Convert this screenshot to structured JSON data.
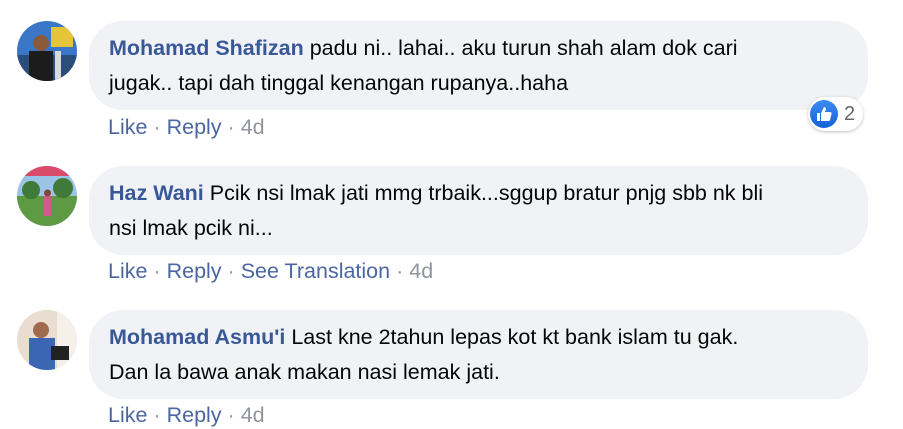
{
  "comments": [
    {
      "author": "Mohamad Shafizan",
      "text": "padu ni.. lahai.. aku turun shah alam dok cari\njugak.. tapi dah tinggal kenangan rupanya..haha",
      "actions": {
        "like": "Like",
        "reply": "Reply"
      },
      "time": "4d",
      "reaction": {
        "icon": "thumbs-up-icon",
        "count": "2"
      }
    },
    {
      "author": "Haz Wani",
      "text": "Pcik nsi lmak jati mmg trbaik...sggup bratur pnjg sbb nk bli\nnsi lmak pcik ni...",
      "actions": {
        "like": "Like",
        "reply": "Reply",
        "translate": "See Translation"
      },
      "time": "4d"
    },
    {
      "author": "Mohamad Asmu'i",
      "text": "Last kne 2tahun lepas kot kt bank islam tu gak.\nDan la bawa anak makan nasi lemak jati.",
      "actions": {
        "like": "Like",
        "reply": "Reply"
      },
      "time": "4d"
    }
  ],
  "separator": "·",
  "colors": {
    "bubble": "#f0f2f5",
    "author": "#385898",
    "link": "#4b67a1",
    "muted": "#90949c",
    "like_blue": "#1877f2"
  }
}
